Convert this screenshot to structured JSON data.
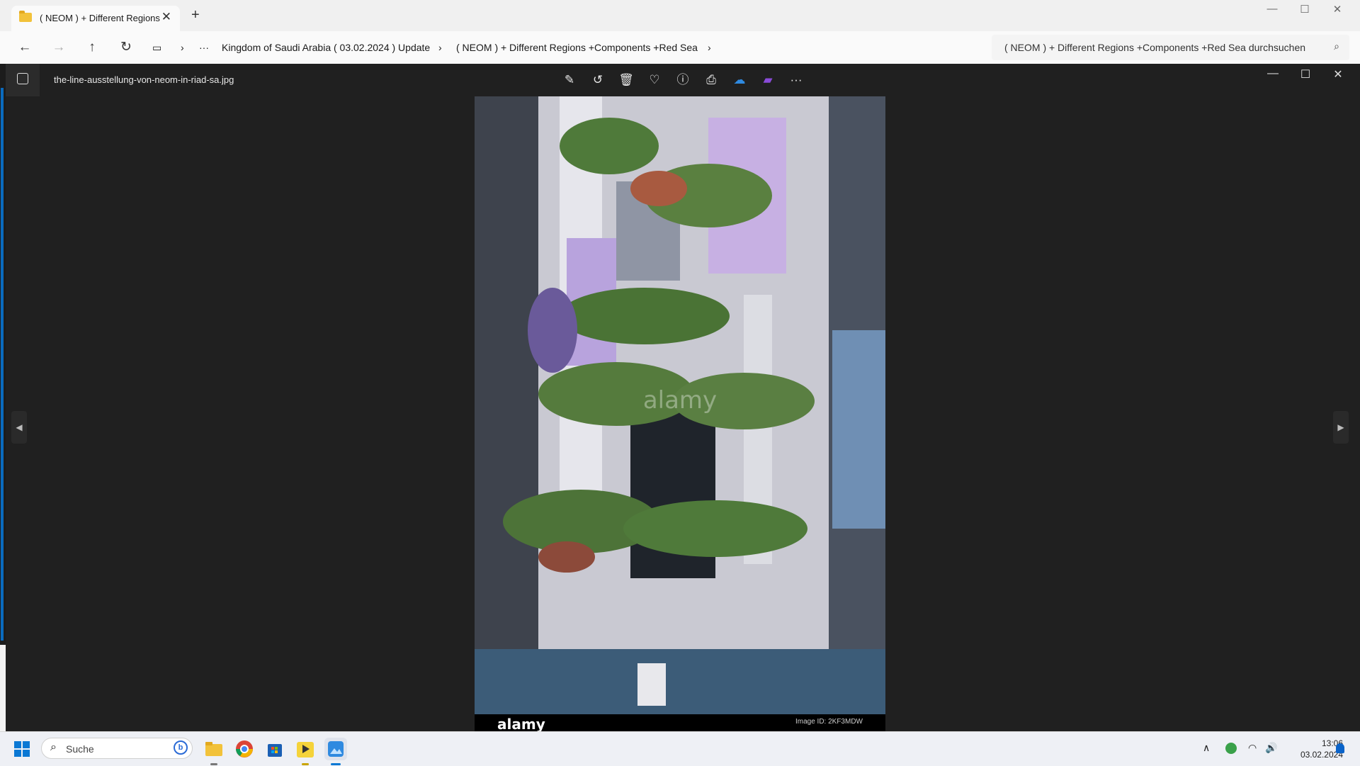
{
  "explorer": {
    "tab_title": "( NEOM ) + Different Regions",
    "tab_close": "✕",
    "new_tab": "+",
    "window_controls": {
      "minimize": "—",
      "maximize": "☐",
      "close": "✕"
    },
    "nav": {
      "back": "←",
      "forward": "→",
      "up": "↑",
      "refresh": "↻",
      "view": "▭",
      "sep1": "›",
      "more": "···"
    },
    "breadcrumbs": [
      {
        "label": "Kingdom of Saudi Arabia ( 03.02.2024 ) Update"
      },
      {
        "label": "( NEOM ) + Different Regions +Components +Red Sea"
      }
    ],
    "crumb_sep": "›",
    "search_placeholder": "( NEOM ) + Different Regions +Components +Red Sea durchsuchen",
    "search_icon": "⌕"
  },
  "photos": {
    "filename": "the-line-ausstellung-von-neom-in-riad-sa.jpg",
    "toolbar": [
      {
        "name": "edit-image-icon",
        "glyph": "✎"
      },
      {
        "name": "rotate-icon",
        "glyph": "↺"
      },
      {
        "name": "delete-icon",
        "glyph": "🗑"
      },
      {
        "name": "favorite-icon",
        "glyph": "♡"
      },
      {
        "name": "info-icon",
        "glyph": "ⓘ"
      },
      {
        "name": "print-icon",
        "glyph": "⎙"
      },
      {
        "name": "onedrive-icon",
        "glyph": "☁"
      },
      {
        "name": "clipchamp-icon",
        "glyph": "▰"
      },
      {
        "name": "more-options-icon",
        "glyph": "···"
      }
    ],
    "window_controls": {
      "minimize": "—",
      "maximize": "☐",
      "close": "✕"
    },
    "prev_arrow": "◀",
    "next_arrow": "▶",
    "watermark": "alamy",
    "image_id": "Image ID: 2KF3MDW"
  },
  "taskbar": {
    "search_label": "Suche",
    "search_icon": "⌕",
    "bing_label": "b",
    "apps": [
      "file-explorer",
      "chrome",
      "microsoft-store",
      "player",
      "photos"
    ],
    "tray": {
      "chevron": "∧",
      "wifi": "◠",
      "volume": "🔊"
    },
    "time": "13:06",
    "date": "03.02.2024"
  },
  "colors": {
    "accent": "#0a78d4",
    "photos_bg": "#202020",
    "folder": "#f2c23a"
  }
}
